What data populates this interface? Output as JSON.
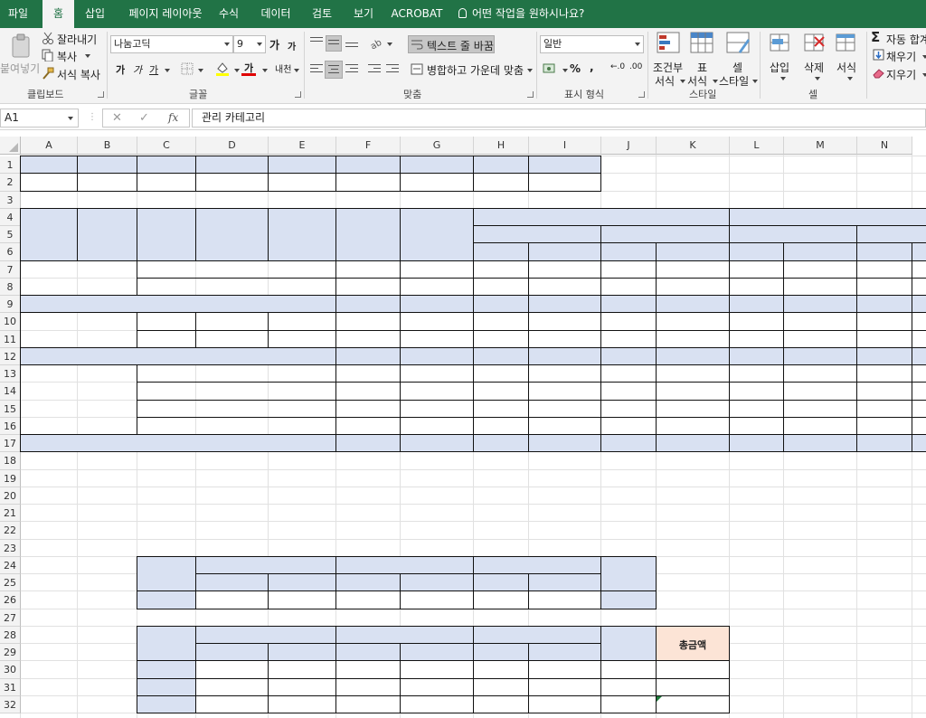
{
  "tabs": [
    {
      "label": "파일",
      "active": false
    },
    {
      "label": "홈",
      "active": true
    },
    {
      "label": "삽입",
      "active": false
    },
    {
      "label": "페이지 레이아웃",
      "active": false
    },
    {
      "label": "수식",
      "active": false
    },
    {
      "label": "데이터",
      "active": false
    },
    {
      "label": "검토",
      "active": false
    },
    {
      "label": "보기",
      "active": false
    },
    {
      "label": "ACROBAT",
      "active": false
    }
  ],
  "tell_me": "어떤 작업을 원하시나요?",
  "ribbon": {
    "clipboard": {
      "paste": "붙여넣기",
      "cut": "잘라내기",
      "copy": "복사",
      "format_painter": "서식 복사",
      "group_label": "클립보드"
    },
    "font": {
      "font_name": "나눔고딕",
      "font_size": "9",
      "grow": "가",
      "shrink": "가",
      "bold": "가",
      "italic": "가",
      "underline": "가",
      "font_color_glyph": "가",
      "phonetic": "내천",
      "group_label": "글꼴"
    },
    "alignment": {
      "wrap_text": "텍스트 줄 바꿈",
      "merge_center": "병합하고 가운데 맞춤",
      "group_label": "맞춤"
    },
    "number": {
      "format": "일반",
      "percent": "%",
      "comma": ",",
      "inc_decimal": "←.0",
      "dec_decimal": ".00",
      "group_label": "표시 형식"
    },
    "styles": {
      "conditional_1": "조건부",
      "conditional_2": "서식",
      "table_1": "표",
      "table_2": "서식",
      "cell_styles_1": "셀",
      "cell_styles_2": "스타일",
      "group_label": "스타일"
    },
    "cells": {
      "insert": "삽입",
      "delete": "삭제",
      "format": "서식",
      "group_label": "셀"
    },
    "editing": {
      "autosum": "자동 합계",
      "fill": "채우기",
      "clear": "지우기"
    }
  },
  "formula_bar": {
    "name_box": "A1",
    "fx": "fx",
    "content": "관리 카테고리"
  },
  "sheet": {
    "columns": [
      "A",
      "B",
      "C",
      "D",
      "E",
      "F",
      "G",
      "H",
      "I",
      "J",
      "K",
      "L",
      "M",
      "N"
    ],
    "rows": [
      "1",
      "2",
      "3",
      "4",
      "5",
      "6",
      "7",
      "8",
      "9",
      "10",
      "11",
      "12",
      "13",
      "14",
      "15",
      "16",
      "17",
      "18",
      "19",
      "20",
      "21",
      "22",
      "23",
      "24",
      "25",
      "26",
      "27",
      "28",
      "29",
      "30",
      "31",
      "32"
    ],
    "total_label": "총금액",
    "fill_color": "#d9e1f2",
    "total_fill_color": "#fce4d6",
    "accent": "#217346"
  }
}
